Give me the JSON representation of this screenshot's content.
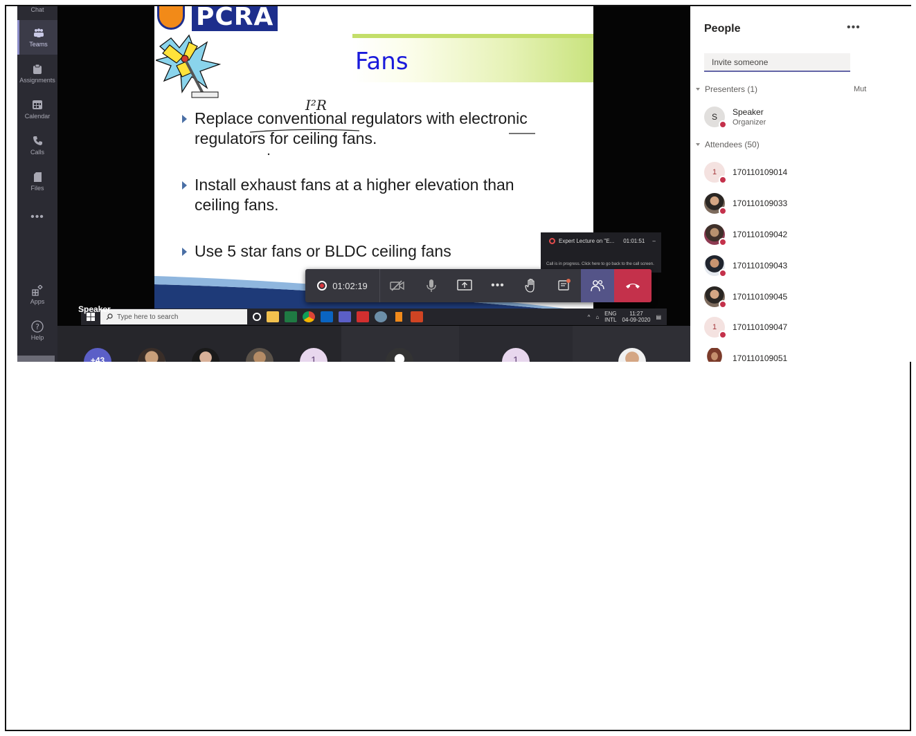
{
  "rail": {
    "chat_label": "Chat",
    "items": [
      {
        "label": "Teams",
        "icon": "teams-icon"
      },
      {
        "label": "Assignments",
        "icon": "assignments-icon"
      },
      {
        "label": "Calendar",
        "icon": "calendar-icon"
      },
      {
        "label": "Calls",
        "icon": "calls-icon"
      },
      {
        "label": "Files",
        "icon": "files-icon"
      }
    ],
    "more_label": "•••",
    "apps_label": "Apps",
    "help_label": "Help"
  },
  "slide": {
    "logo_text": "PCRA",
    "title": "Fans",
    "bullets": [
      "Replace conventional regulators with electronic regulators for ceiling fans.",
      "Install exhaust fans at a higher elevation than ceiling fans.",
      "Use 5 star fans or BLDC ceiling fans"
    ],
    "annotation": "I²R"
  },
  "mini_window": {
    "title": "Expert Lecture on \"E...",
    "time": "01:01:51",
    "hint": "Call is in progress. Click here to go back to the call screen."
  },
  "call_toolbar": {
    "timer": "01:02:19"
  },
  "speaker_label": "Speaker",
  "taskbar": {
    "search_placeholder": "Type here to search",
    "lang_top": "ENG",
    "lang_bottom": "INTL",
    "time": "11:27",
    "date": "04-09-2020"
  },
  "gallery": {
    "overflow_count": "+43",
    "tile_initial_1": "1",
    "tile_initial_2": "1"
  },
  "people_panel": {
    "title": "People",
    "more": "•••",
    "invite_placeholder": "Invite someone",
    "presenters_label": "Presenters (1)",
    "mute_all": "Mut",
    "attendees_label": "Attendees (50)",
    "presenters": [
      {
        "initial": "S",
        "name": "Speaker",
        "role": "Organizer"
      }
    ],
    "attendees": [
      {
        "name": "170110109014",
        "initial": "1",
        "avatar": "letter"
      },
      {
        "name": "170110109033",
        "initial": "",
        "avatar": "photo"
      },
      {
        "name": "170110109042",
        "initial": "",
        "avatar": "photo2"
      },
      {
        "name": "170110109043",
        "initial": "",
        "avatar": "photo3"
      },
      {
        "name": "170110109045",
        "initial": "",
        "avatar": "photo"
      },
      {
        "name": "170110109047",
        "initial": "1",
        "avatar": "letter"
      },
      {
        "name": "170110109051",
        "initial": "",
        "avatar": "photo2"
      }
    ]
  }
}
